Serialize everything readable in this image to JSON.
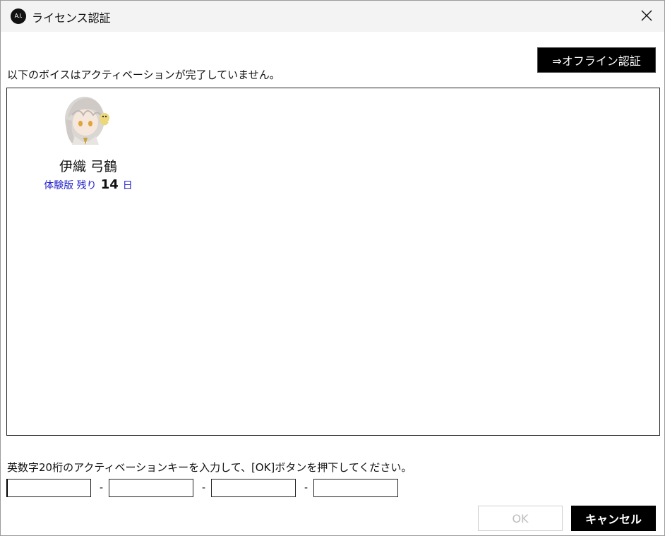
{
  "window": {
    "title": "ライセンス認証",
    "app_icon_text": "A.I."
  },
  "header": {
    "offline_button_label": "⇒オフライン認証"
  },
  "notice_text": "以下のボイスはアクティベーションが完了していません。",
  "voices": [
    {
      "name": "伊織 弓鶴",
      "trial_label": "体験版 残り",
      "trial_days": "14",
      "trial_unit": "日"
    }
  ],
  "activation": {
    "instruction": "英数字20桁のアクティベーションキーを入力して、[OK]ボタンを押下してください。",
    "separator": "-",
    "fields": [
      "",
      "",
      "",
      ""
    ]
  },
  "footer": {
    "ok_label": "OK",
    "cancel_label": "キャンセル"
  },
  "colors": {
    "accent_text": "#2222cc",
    "button_dark": "#000000",
    "disabled_text": "#bdbdbd"
  }
}
